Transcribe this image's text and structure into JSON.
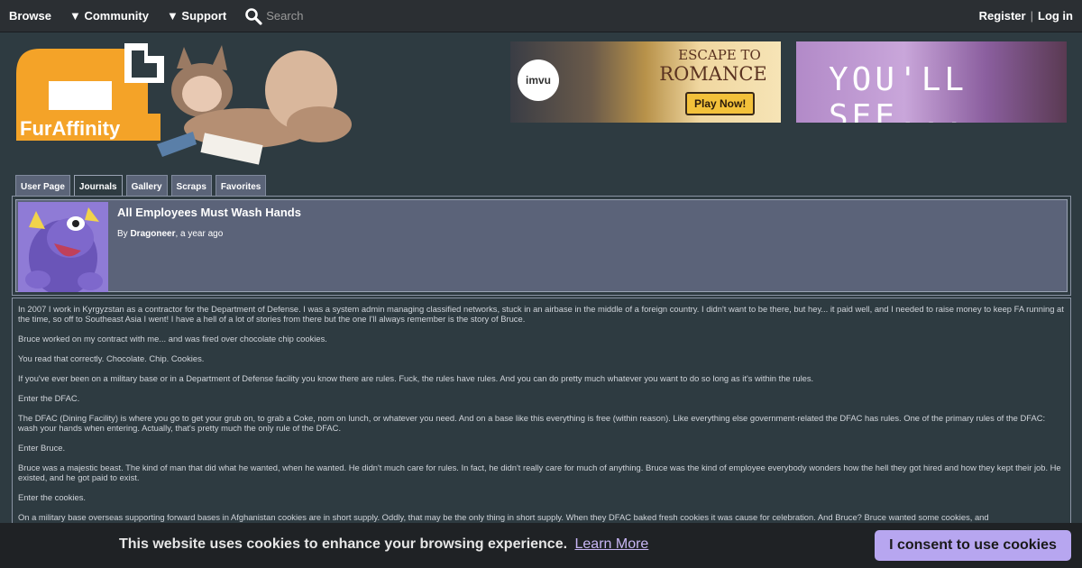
{
  "nav": {
    "browse": "Browse",
    "community": "▼ Community",
    "support": "▼ Support",
    "search_placeholder": "Search",
    "register": "Register",
    "separator": "|",
    "login": "Log in"
  },
  "logo": {
    "text": "FurAffinity"
  },
  "ads": {
    "ad1": {
      "brand": "imvu",
      "line1": "ESCAPE TO",
      "line2": "ROMANCE",
      "cta": "Play Now!"
    },
    "ad2": {
      "text": "YOU'LL SEE..."
    }
  },
  "tabs": [
    {
      "label": "User Page"
    },
    {
      "label": "Journals"
    },
    {
      "label": "Gallery"
    },
    {
      "label": "Scraps"
    },
    {
      "label": "Favorites"
    }
  ],
  "journal": {
    "title": "All Employees Must Wash Hands",
    "by": "By",
    "author": "Dragoneer",
    "time": ", a year ago",
    "paragraphs": [
      "In 2007 I work in Kyrgyzstan as a contractor for the Department of Defense. I was a system admin managing classified networks, stuck in an airbase in the middle of a foreign country. I didn't want to be there, but hey... it paid well, and I needed to raise money to keep FA running at the time, so off to Southeast Asia I went! I have a hell of a lot of stories from there but the one I'll always remember is the story of Bruce.",
      "Bruce worked on my contract with me... and was fired over chocolate chip cookies.",
      "You read that correctly. Chocolate. Chip. Cookies.",
      "If you've ever been on a military base or in a Department of Defense facility you know there are rules. Fuck, the rules have rules. And you can do pretty much whatever you want to do so long as it's within the rules.",
      "Enter the DFAC.",
      "The DFAC (Dining Facility) is where you go to get your grub on, to grab a Coke, nom on lunch, or whatever you need. And on a base like this everything is free (within reason). Like everything else government-related the DFAC has rules. One of the primary rules of the DFAC: wash your hands when entering. Actually, that's pretty much the only rule of the DFAC.",
      "Enter Bruce.",
      "Bruce was a majestic beast. The kind of man that did what he wanted, when he wanted. He didn't much care for rules. In fact, he didn't really care for much of anything. Bruce was the kind of employee everybody wonders how the hell they got hired and how they kept their job. He existed, and he got paid to exist.",
      "Enter the cookies.",
      "On a military base overseas supporting forward bases in Afghanistan cookies are in short supply. Oddly, that may be the only thing in short supply. When they DFAC baked fresh cookies it was cause for celebration. And Bruce? Bruce wanted some cookies, and"
    ]
  },
  "cookie": {
    "message": "This website uses cookies to enhance your browsing experience.",
    "link": "Learn More",
    "button": "I consent to use cookies"
  }
}
